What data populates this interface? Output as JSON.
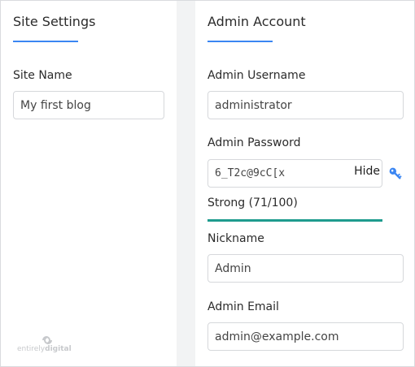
{
  "site_settings": {
    "title": "Site Settings",
    "site_name_label": "Site Name",
    "site_name_value": "My first blog"
  },
  "admin_account": {
    "title": "Admin Account",
    "username_label": "Admin Username",
    "username_value": "administrator",
    "password_label": "Admin Password",
    "password_value": "6_T2c@9cC[x",
    "hide_label": "Hide",
    "strength_text": "Strong (71/100)",
    "strength_score": 71,
    "strength_max": 100,
    "nickname_label": "Nickname",
    "nickname_value": "Admin",
    "email_label": "Admin Email",
    "email_value": "admin@example.com"
  },
  "logo": {
    "text_part1": "entirely",
    "text_part2": "digital"
  },
  "colors": {
    "accent": "#3b86f2",
    "strength": "#1e9b8e",
    "panel_bg": "#ffffff",
    "page_bg": "#f2f3f4"
  },
  "icons": {
    "password_generate": "key-icon",
    "logo": "entirelydigital-logo-icon"
  }
}
